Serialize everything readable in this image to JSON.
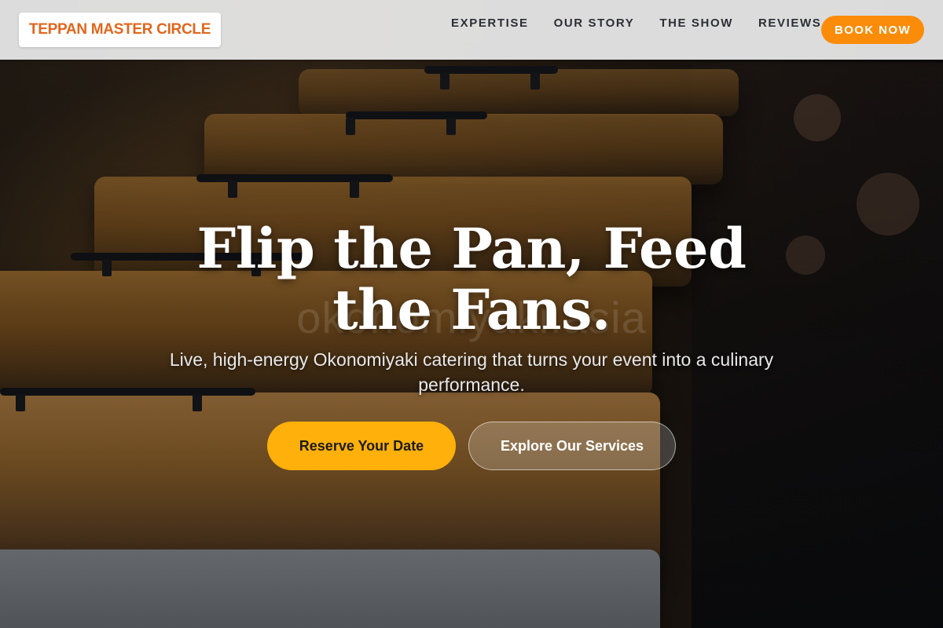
{
  "header": {
    "logo_text": "TEPPAN MASTER CIRCLE",
    "nav": [
      {
        "label": "EXPERTISE"
      },
      {
        "label": "OUR STORY"
      },
      {
        "label": "THE SHOW"
      },
      {
        "label": "REVIEWS"
      }
    ],
    "book_label": "BOOK NOW"
  },
  "hero": {
    "headline": "Flip the Pan, Feed the Fans.",
    "watermark": "okonomiyaki.asia",
    "subline": "Live, high-energy Okonomiyaki catering that turns your event into a culinary performance.",
    "primary_cta": "Reserve Your Date",
    "secondary_cta": "Explore Our Services",
    "background_image": "chafing-dish-trays-photo"
  },
  "colors": {
    "brand_orange": "#e2661c",
    "book_button": "#fb8c0a",
    "primary_cta": "#ffb00a"
  }
}
